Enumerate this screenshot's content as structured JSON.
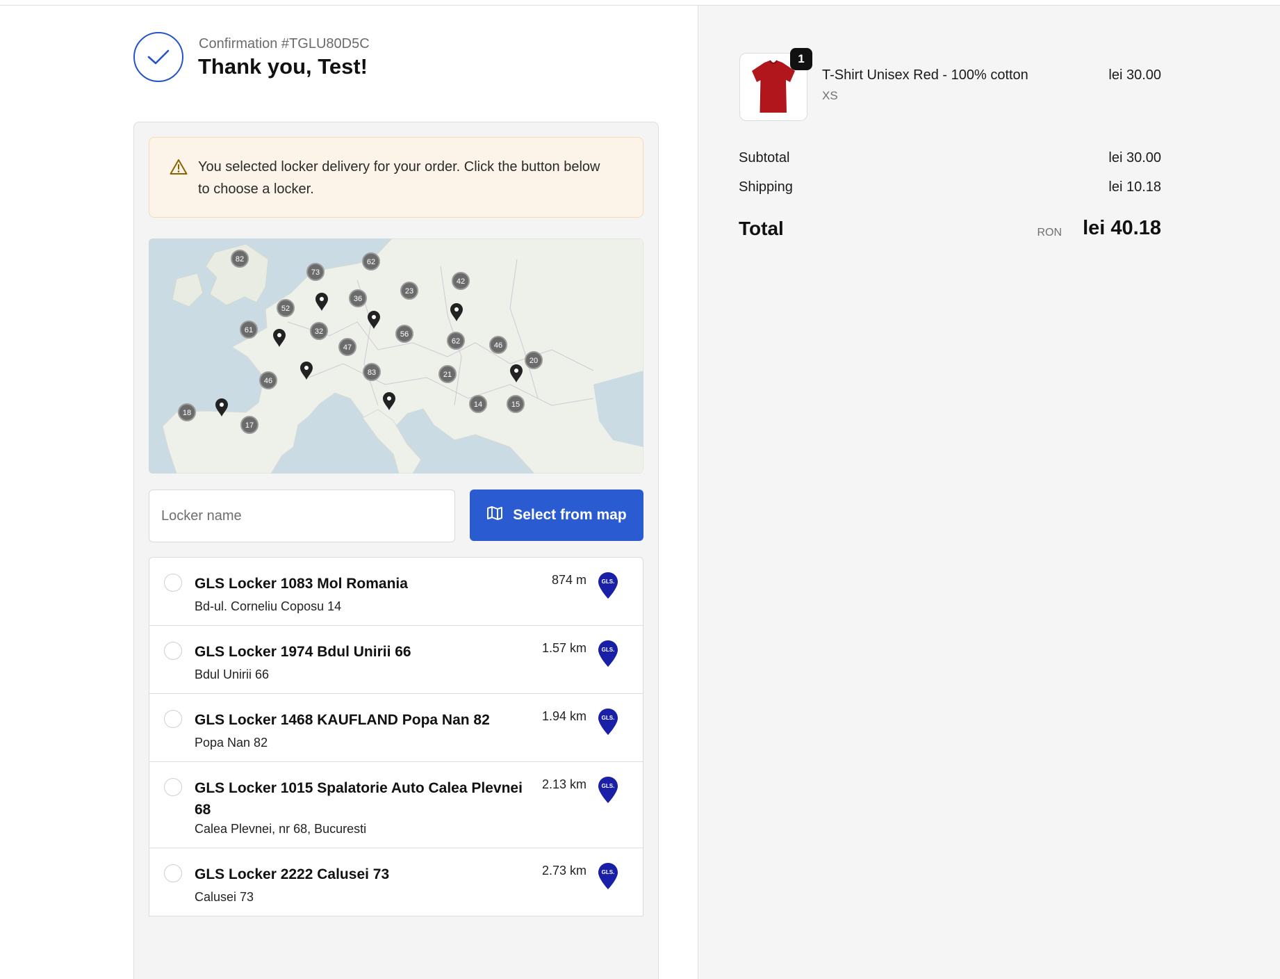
{
  "header": {
    "confirmation": "Confirmation #TGLU80D5C",
    "title": "Thank you, Test!"
  },
  "alert": {
    "text": "You selected locker delivery for your order. Click the button below to choose a locker."
  },
  "map": {
    "clusters": [
      "82",
      "73",
      "62",
      "42",
      "23",
      "36",
      "52",
      "61",
      "32",
      "47",
      "56",
      "62",
      "46",
      "20",
      "83",
      "21",
      "46",
      "14",
      "15",
      "18",
      "17"
    ]
  },
  "locker_search": {
    "placeholder": "Locker name",
    "button_label": "Select from map"
  },
  "lockers": [
    {
      "name": "GLS Locker 1083 Mol Romania",
      "distance": "874 m",
      "address": "Bd-ul. Corneliu Coposu 14"
    },
    {
      "name": "GLS Locker 1974 Bdul Unirii 66",
      "distance": "1.57 km",
      "address": "Bdul Unirii 66"
    },
    {
      "name": "GLS Locker 1468 KAUFLAND Popa Nan 82",
      "distance": "1.94 km",
      "address": "Popa Nan 82"
    },
    {
      "name": "GLS Locker 1015 Spalatorie Auto Calea Plevnei 68",
      "distance": "2.13 km",
      "address": "Calea Plevnei, nr 68, Bucuresti"
    },
    {
      "name": "GLS Locker 2222 Calusei 73",
      "distance": "2.73 km",
      "address": "Calusei 73"
    }
  ],
  "carrier_logo_text": "GLS.",
  "summary": {
    "product": {
      "name": "T-Shirt Unisex Red - 100% cotton",
      "variant": "XS",
      "price": "lei 30.00",
      "quantity": "1"
    },
    "subtotal_label": "Subtotal",
    "subtotal": "lei 30.00",
    "shipping_label": "Shipping",
    "shipping": "lei 10.18",
    "total_label": "Total",
    "currency": "RON",
    "total": "lei 40.18"
  },
  "colors": {
    "accent": "#2a5bd1",
    "check": "#2454c8",
    "gls_blue": "#1a1fa8",
    "alert_bg": "#fcf4e8",
    "tshirt": "#b0161b"
  }
}
